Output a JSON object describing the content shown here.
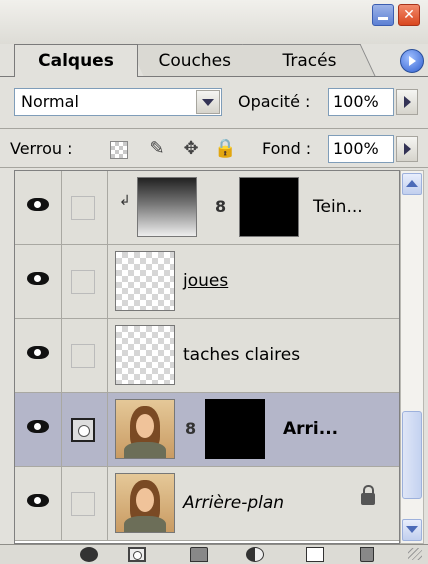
{
  "tabs": [
    {
      "label": "Calques",
      "active": true
    },
    {
      "label": "Couches",
      "active": false
    },
    {
      "label": "Tracés",
      "active": false
    }
  ],
  "blend_mode": "Normal",
  "opacity": {
    "label": "Opacité :",
    "value": "100%"
  },
  "lock": {
    "label": "Verrou :"
  },
  "fill": {
    "label": "Fond :",
    "value": "100%"
  },
  "layers": [
    {
      "name": "Tein...",
      "type": "adjustment",
      "selected": false
    },
    {
      "name": "joues",
      "type": "pixel",
      "selected": false
    },
    {
      "name": "taches claires",
      "type": "pixel",
      "selected": false
    },
    {
      "name": "Arri...",
      "type": "masked",
      "selected": true
    },
    {
      "name": "Arrière-plan",
      "type": "background",
      "selected": false
    }
  ],
  "colors": {
    "selected_row": "#b4b6c9",
    "panel": "#e2e1dc"
  }
}
